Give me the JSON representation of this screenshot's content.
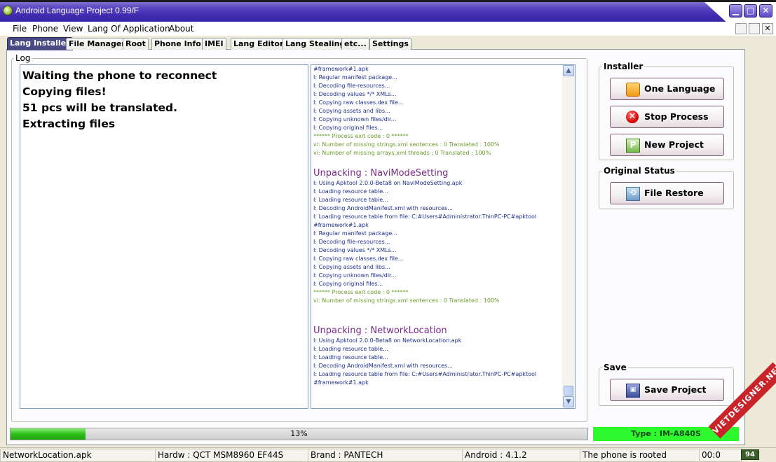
{
  "window": {
    "title": "Android Language Project 0.99/F",
    "min_glyph": "▁",
    "max_glyph": "□",
    "close_glyph": "✕"
  },
  "menu": [
    "File",
    "Phone",
    "View",
    "Lang Of Application",
    "About"
  ],
  "tabs": [
    "Lang Installer",
    "File Manager",
    "Root",
    "Phone Info",
    "IMEI",
    "Lang Editor",
    "Lang Stealing",
    "etc...",
    "Settings"
  ],
  "log": {
    "legend": "Log",
    "lines": [
      "Waiting the phone to reconnect",
      "Copying files!",
      "51 pcs will be translated.",
      "Extracting files"
    ],
    "detail": [
      {
        "t": "#framework#1.apk",
        "k": ""
      },
      {
        "t": "I: Regular manifest package...",
        "k": ""
      },
      {
        "t": "I: Decoding file-resources...",
        "k": ""
      },
      {
        "t": "I: Decoding values */* XMLs...",
        "k": ""
      },
      {
        "t": "I: Copying raw classes.dex file...",
        "k": ""
      },
      {
        "t": "I: Copying assets and libs...",
        "k": ""
      },
      {
        "t": "I: Copying unknown files/dir...",
        "k": ""
      },
      {
        "t": "I: Copying original files...",
        "k": ""
      },
      {
        "t": "****** Process exit code : 0 ******",
        "k": "green"
      },
      {
        "t": "vi: Number of missing strings.xml sentences : 0 Translated : 100%",
        "k": "green"
      },
      {
        "t": "vi: Number of missing arrays.xml threads : 0 Translated : 100%",
        "k": "green"
      },
      {
        "t": "",
        "k": "gap"
      },
      {
        "t": "Unpacking : NaviModeSetting",
        "k": "head"
      },
      {
        "t": "I: Using Apktool 2.0.0-Beta8 on NaviModeSetting.apk",
        "k": ""
      },
      {
        "t": "I: Loading resource table...",
        "k": ""
      },
      {
        "t": "I: Loading resource table...",
        "k": ""
      },
      {
        "t": "I: Decoding AndroidManifest.xml with resources...",
        "k": ""
      },
      {
        "t": "I: Loading resource table from file: C:#Users#Administrator.ThinPC-PC#apktool",
        "k": ""
      },
      {
        "t": "#framework#1.apk",
        "k": ""
      },
      {
        "t": "I: Regular manifest package...",
        "k": ""
      },
      {
        "t": "I: Decoding file-resources...",
        "k": ""
      },
      {
        "t": "I: Decoding values */* XMLs...",
        "k": ""
      },
      {
        "t": "I: Copying raw classes.dex file...",
        "k": ""
      },
      {
        "t": "I: Copying assets and libs...",
        "k": ""
      },
      {
        "t": "I: Copying unknown files/dir...",
        "k": ""
      },
      {
        "t": "I: Copying original files...",
        "k": ""
      },
      {
        "t": "****** Process exit code : 0 ******",
        "k": "green"
      },
      {
        "t": "vi: Number of missing strings.xml sentences : 0 Translated : 100%",
        "k": "green"
      },
      {
        "t": "",
        "k": "gap"
      },
      {
        "t": "",
        "k": "gap"
      },
      {
        "t": "Unpacking : NetworkLocation",
        "k": "head"
      },
      {
        "t": "I: Using Apktool 2.0.0-Beta8 on NetworkLocation.apk",
        "k": ""
      },
      {
        "t": "I: Loading resource table...",
        "k": ""
      },
      {
        "t": "I: Loading resource table...",
        "k": ""
      },
      {
        "t": "I: Decoding AndroidManifest.xml with resources...",
        "k": ""
      },
      {
        "t": "I: Loading resource table from file: C:#Users#Administrator.ThinPC-PC#apktool",
        "k": ""
      },
      {
        "t": "#framework#1.apk",
        "k": ""
      }
    ]
  },
  "installer": {
    "legend": "Installer",
    "one_language": "One Language",
    "stop_process": "Stop Process",
    "new_project": "New Project"
  },
  "original_status": {
    "legend": "Original Status",
    "file_restore": "File Restore"
  },
  "save": {
    "legend": "Save",
    "save_project": "Save Project"
  },
  "progress": {
    "value": 0.13,
    "label": "13%"
  },
  "type_label": "Type : IM-A840S",
  "status": {
    "file": "NetworkLocation.apk",
    "hardware": "Hardw : QCT MSM8960 EF44S",
    "brand": "Brand : PANTECH",
    "android": "Android : 4.1.2",
    "rooted": "The phone is rooted",
    "time": "00:0",
    "battery": "94"
  },
  "watermark": "VIETDESIGNER.NET",
  "colors": {
    "titlebar": "#3f2bb0",
    "progress_green": "#2fc018",
    "type_green": "#2ef82e",
    "log_blue": "#1c2f8a",
    "log_green": "#6a9a2a",
    "log_head": "#7a2a8a"
  }
}
